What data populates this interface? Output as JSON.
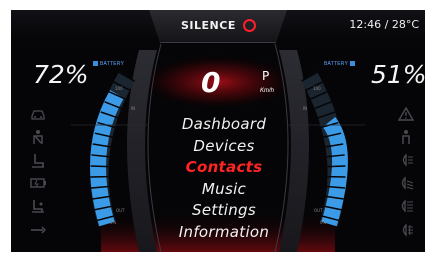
{
  "header": {
    "brand": "SILENCE",
    "clock": "12:46 / 28°C"
  },
  "battery_left": {
    "percent": "72%",
    "label": "BATTERY",
    "gauge_fill": 0.72
  },
  "battery_right": {
    "percent": "51%",
    "label": "BATTERY",
    "gauge_fill": 0.51
  },
  "speedometer": {
    "speed": "0",
    "gear": "P",
    "unit": "Km/h"
  },
  "menu": {
    "items": [
      {
        "label": "Dashboard",
        "active": false
      },
      {
        "label": "Devices",
        "active": false
      },
      {
        "label": "Contacts",
        "active": true
      },
      {
        "label": "Music",
        "active": false
      },
      {
        "label": "Settings",
        "active": false
      },
      {
        "label": "Information",
        "active": false
      }
    ]
  },
  "left_icons": [
    "car-front-icon",
    "seat-belt-icon",
    "seat-heater-icon",
    "battery-charge-icon",
    "seat-icon",
    "wrench-icon"
  ],
  "right_icons": [
    "warning-triangle-icon",
    "person-icon",
    "headlight-icon",
    "low-beam-icon",
    "high-beam-icon",
    "fog-light-icon"
  ],
  "colors": {
    "accent_red": "#ff1f2a",
    "gauge_blue": "#3b9be6",
    "menu_active": "#ff2424"
  }
}
